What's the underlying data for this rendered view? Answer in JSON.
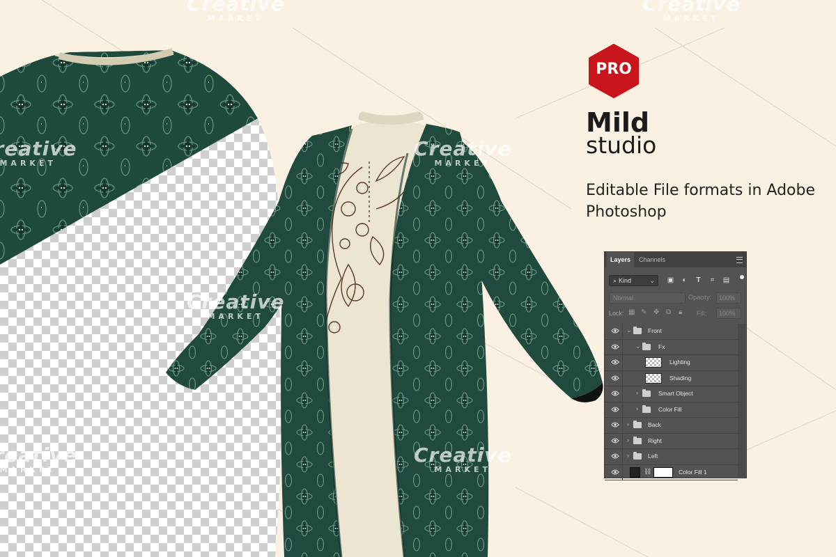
{
  "brand": {
    "badge": "PRO",
    "badge_color": "#c8141b",
    "name_line1": "Mild",
    "name_line2": "studio"
  },
  "tagline": "Editable File formats in Adobe Photoshop",
  "watermark": {
    "word": "Creative",
    "sub": "MARKET"
  },
  "photoshop_panel": {
    "tabs": [
      "Layers",
      "Channels"
    ],
    "active_tab": "Layers",
    "filter_kind": "Kind",
    "blend_mode": "Normal",
    "opacity_label": "Opacity:",
    "opacity_value": "100%",
    "lock_label": "Lock:",
    "fill_label": "Fill:",
    "fill_value": "100%",
    "layers": [
      {
        "name": "Front",
        "type": "group",
        "expanded": true,
        "indent": 0
      },
      {
        "name": "Fx",
        "type": "group",
        "expanded": true,
        "indent": 1
      },
      {
        "name": "Lighting",
        "type": "layer",
        "indent": 2
      },
      {
        "name": "Shading",
        "type": "layer",
        "indent": 2
      },
      {
        "name": "Smart Object",
        "type": "group",
        "expanded": false,
        "indent": 1
      },
      {
        "name": "Color Fill",
        "type": "group",
        "expanded": false,
        "indent": 1
      },
      {
        "name": "Back",
        "type": "group",
        "expanded": false,
        "indent": 0
      },
      {
        "name": "Right",
        "type": "group",
        "expanded": false,
        "indent": 0
      },
      {
        "name": "Left",
        "type": "group",
        "expanded": false,
        "indent": 0
      },
      {
        "name": "Color Fill 1",
        "type": "fill",
        "indent": 0
      }
    ]
  },
  "colors": {
    "background": "#fbf1e3",
    "garment_green": "#1f4a3c",
    "garment_cream": "#ece5d3",
    "embroidery": "#5a3a25",
    "panel_bg": "#535353"
  }
}
